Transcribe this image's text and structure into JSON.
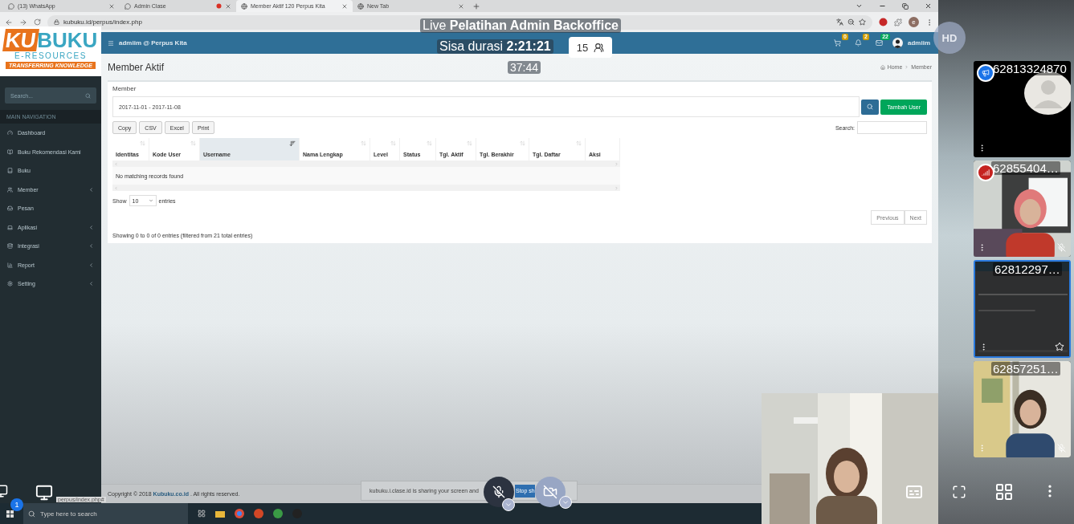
{
  "browser": {
    "tabs": [
      {
        "label": "(13) WhatsApp",
        "selected": false,
        "recording": false
      },
      {
        "label": "Admin Clase",
        "selected": false,
        "recording": true
      },
      {
        "label": "Member Aktif 120 Perpus Kita",
        "selected": true,
        "recording": false
      },
      {
        "label": "New Tab",
        "selected": false,
        "recording": false
      }
    ],
    "address": "kubuku.id/perpus/index.php",
    "profile_initial": "e"
  },
  "app": {
    "brand": "admiim @ Perpus Kita",
    "notifications": [
      {
        "count": "0",
        "color": "#d39e00"
      },
      {
        "count": "2",
        "color": "#d39e00"
      },
      {
        "count": "22",
        "color": "#00a65a"
      }
    ],
    "user": "admiim",
    "sidebar": {
      "search_placeholder": "Search...",
      "section": "MAIN NAVIGATION",
      "items": [
        {
          "label": "Dashboard",
          "has_submenu": false
        },
        {
          "label": "Buku Rekomendasi Kami",
          "has_submenu": false
        },
        {
          "label": "Buku",
          "has_submenu": false
        },
        {
          "label": "Member",
          "has_submenu": true
        },
        {
          "label": "Pesan",
          "has_submenu": false
        },
        {
          "label": "Aplikasi",
          "has_submenu": true
        },
        {
          "label": "Integrasi",
          "has_submenu": true
        },
        {
          "label": "Report",
          "has_submenu": true
        },
        {
          "label": "Setting",
          "has_submenu": true
        }
      ]
    },
    "page_title": "Member Aktif",
    "breadcrumb": [
      "Home",
      "Member"
    ],
    "box_title": "Member",
    "date_range": "2017-11-01 - 2017-11-08",
    "add_button": "Tambah User",
    "export_buttons": [
      "Copy",
      "CSV",
      "Excel",
      "Print"
    ],
    "search_label": "Search:",
    "columns": [
      {
        "label": "Identitas",
        "sortable": true,
        "sorted": false
      },
      {
        "label": "Kode User",
        "sortable": true,
        "sorted": false
      },
      {
        "label": "Username",
        "sortable": true,
        "sorted": true
      },
      {
        "label": "Nama Lengkap",
        "sortable": true,
        "sorted": false
      },
      {
        "label": "Level",
        "sortable": true,
        "sorted": false
      },
      {
        "label": "Status",
        "sortable": true,
        "sorted": false
      },
      {
        "label": "Tgl. Aktif",
        "sortable": true,
        "sorted": false
      },
      {
        "label": "Tgl. Berakhir",
        "sortable": true,
        "sorted": false
      },
      {
        "label": "Tgl. Daftar",
        "sortable": true,
        "sorted": false
      },
      {
        "label": "Aksi",
        "sortable": false,
        "sorted": false
      }
    ],
    "empty_message": "No matching records found",
    "show_label": "Show",
    "page_size": "10",
    "entries_label": "entries",
    "info": "Showing 0 to 0 of 0 entries (filtered from 21 total entries)",
    "pagination": [
      "Previous",
      "Next"
    ],
    "footer": {
      "prefix": "Copyright © 2018",
      "link": "Kubuku.co.id",
      "suffix": ". All rights reserved."
    },
    "status_url": "perpus/index.php#",
    "taskbar_search": "Type here to search"
  },
  "call": {
    "logo": {
      "mark": "KU",
      "name": "BUKU",
      "subtitle": "E-RESOURCES",
      "tagline": "TRANSFERRING KNOWLEDGE"
    },
    "title": "Live **Pelatihan Admin Backoffice**",
    "remaining": "Sisa durasi **2:21:21**",
    "participants": "15",
    "elapsed": "37:44",
    "quality": "HD",
    "share_notice": "kubuku.i.clase.id is sharing your screen and",
    "stop_button": "Stop sh",
    "mic_muted": true,
    "camera_off": true,
    "badge": "1",
    "tiles": [
      {
        "name": "62813324870",
        "kind": "avatar",
        "presenter": true,
        "weak_signal": false,
        "muted": false,
        "selected": false
      },
      {
        "name": "62855404…",
        "kind": "video",
        "presenter": false,
        "weak_signal": true,
        "muted": true,
        "selected": false
      },
      {
        "name": "62812297…",
        "kind": "screen",
        "presenter": false,
        "weak_signal": false,
        "muted": false,
        "selected": true
      },
      {
        "name": "62857251…",
        "kind": "video",
        "presenter": false,
        "weak_signal": false,
        "muted": true,
        "selected": false
      }
    ]
  }
}
